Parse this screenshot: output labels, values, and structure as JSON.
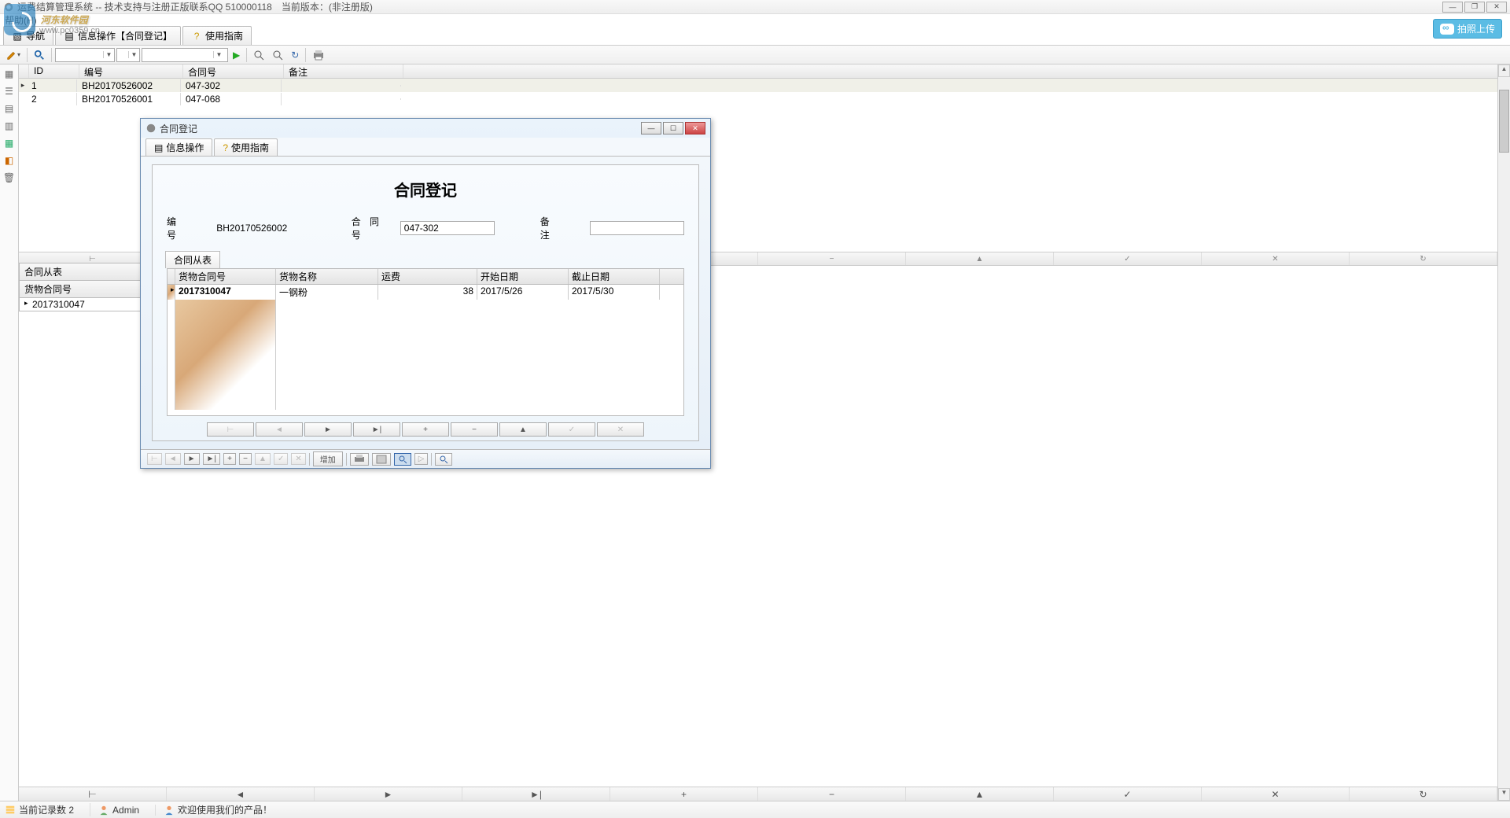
{
  "titlebar": {
    "text": "运费结算管理系统 -- 技术支持与注册正版联系QQ 510000118　当前版本：(非注册版)"
  },
  "menubar": {
    "help": "帮助(H)"
  },
  "upload": {
    "label": "拍照上传"
  },
  "tabs": {
    "nav": "导航",
    "info": "信息操作【合同登记】",
    "guide": "使用指南"
  },
  "main_grid": {
    "headers": {
      "id": "ID",
      "bh": "编号",
      "hth": "合同号",
      "bz": "备注"
    },
    "rows": [
      {
        "id": "1",
        "bh": "BH20170526002",
        "hth": "047-302",
        "bz": ""
      },
      {
        "id": "2",
        "bh": "BH20170526001",
        "hth": "047-068",
        "bz": ""
      }
    ]
  },
  "sub_panel": {
    "title": "合同从表",
    "header": "货物合同号",
    "row": "2017310047"
  },
  "dialog": {
    "title": "合同登记",
    "tabs": {
      "info": "信息操作",
      "guide": "使用指南"
    },
    "heading": "合同登记",
    "form": {
      "bh_label": "编　　号",
      "bh_value": "BH20170526002",
      "hth_label": "合 同 号",
      "hth_value": "047-302",
      "bz_label": "备　　注",
      "bz_value": ""
    },
    "subtab": "合同从表",
    "sub_headers": {
      "h1": "货物合同号",
      "h2": "货物名称",
      "h3": "运费",
      "h4": "开始日期",
      "h5": "截止日期"
    },
    "sub_row": {
      "c1": "2017310047",
      "c2": "一钢粉",
      "c3": "38",
      "c4": "2017/5/26",
      "c5": "2017/5/30"
    },
    "nav": {
      "first": "⊢",
      "prev": "◄",
      "play": "►",
      "last": "►|",
      "plus": "+",
      "minus": "−",
      "up": "▲",
      "check": "✓",
      "x": "✕"
    },
    "footer": {
      "add": "增加"
    }
  },
  "statusbar": {
    "records": "当前记录数 2",
    "user": "Admin",
    "welcome": "欢迎使用我们的产品！"
  },
  "watermark": {
    "text": "河东软件园",
    "url": "www.pc0359.cn"
  }
}
